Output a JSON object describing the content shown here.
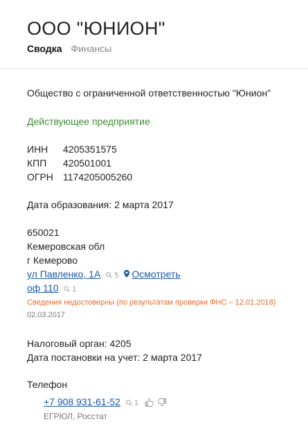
{
  "header": {
    "title": "ООО \"ЮНИОН\"",
    "tabs": [
      {
        "label": "Сводка",
        "active": true
      },
      {
        "label": "Финансы",
        "active": false
      }
    ]
  },
  "company": {
    "full_name": "Общество с ограниченной ответственностью \"Юнион\"",
    "status": "Действующее предприятие",
    "status_color": "#3d8b32"
  },
  "requisites": [
    {
      "label": "ИНН",
      "value": "4205351575"
    },
    {
      "label": "КПП",
      "value": "420501001"
    },
    {
      "label": "ОГРН",
      "value": "1174205005260"
    }
  ],
  "registration": {
    "formation_date": "Дата образования: 2 марта 2017"
  },
  "address": {
    "postal_code": "650021",
    "region": "Кемеровская обл",
    "city": "г Кемерово",
    "street": "ул Павленко, 1А",
    "street_views": "5",
    "view_map_label": "Осмотреть",
    "office": "оф 110",
    "office_views": "1",
    "warning": "Сведения недостоверны (по результатам проверки ФНС – 12.01.2018)",
    "warning_color": "#e36b2c",
    "date": "02.03.2017"
  },
  "tax": {
    "authority": "Налоговый орган: 4205",
    "registration_date": "Дата постановки на учет: 2 марта 2017"
  },
  "phone": {
    "heading": "Телефон",
    "number": "+7 908 931-61-52",
    "views": "1",
    "source": "ЕГРЮЛ, Росстат"
  }
}
